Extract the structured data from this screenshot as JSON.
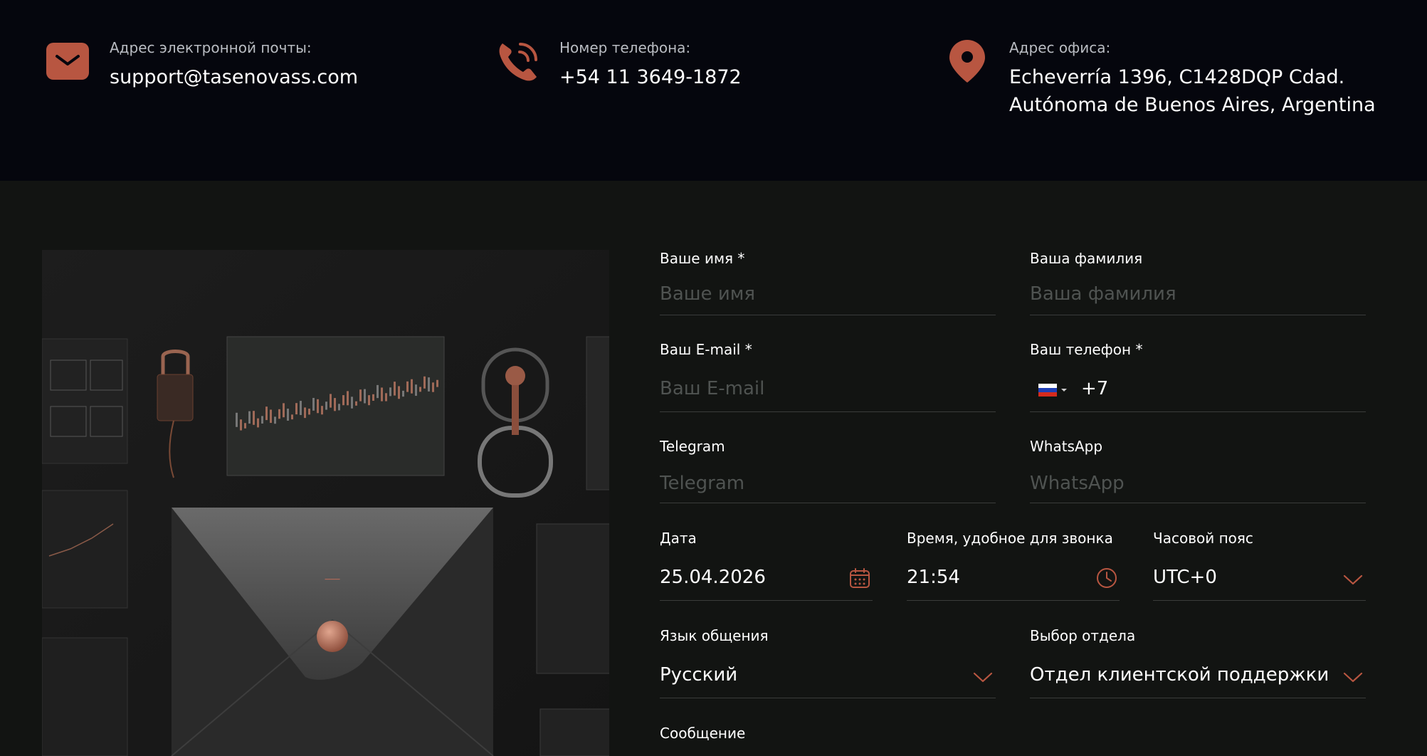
{
  "contacts": [
    {
      "label": "Адрес электронной почты:",
      "value": "support@tasenovass.com",
      "icon": "mail-icon"
    },
    {
      "label": "Номер телефона:",
      "value": "+54 11 3649-1872",
      "icon": "phone-icon"
    },
    {
      "label": "Адрес офиса:",
      "value_line1": "Echeverría 1396, C1428DQP Cdad.",
      "value_line2": "Autónoma de Buenos Aires, Argentina",
      "icon": "location-pin-icon"
    }
  ],
  "form": {
    "first_name": {
      "label": "Ваше имя *",
      "placeholder": "Ваше имя"
    },
    "last_name": {
      "label": "Ваша фамилия",
      "placeholder": "Ваша фамилия"
    },
    "email": {
      "label": "Ваш E-mail *",
      "placeholder": "Ваш E-mail"
    },
    "phone": {
      "label": "Ваш телефон *",
      "prefix": "+7",
      "country": "RU"
    },
    "telegram": {
      "label": "Telegram",
      "placeholder": "Telegram"
    },
    "whatsapp": {
      "label": "WhatsApp",
      "placeholder": "WhatsApp"
    },
    "date": {
      "label": "Дата",
      "value": "25.04.2026"
    },
    "time": {
      "label": "Время, удобное для звонка",
      "value": "21:54"
    },
    "timezone": {
      "label": "Часовой пояс",
      "value": "UTC+0"
    },
    "language": {
      "label": "Язык общения",
      "value": "Русский"
    },
    "department": {
      "label": "Выбор отдела",
      "value": "Отдел клиентской поддержки"
    },
    "message": {
      "label": "Сообщение"
    }
  },
  "colors": {
    "accent": "#b85641",
    "top_background": "#05060d",
    "main_background": "#121412"
  }
}
